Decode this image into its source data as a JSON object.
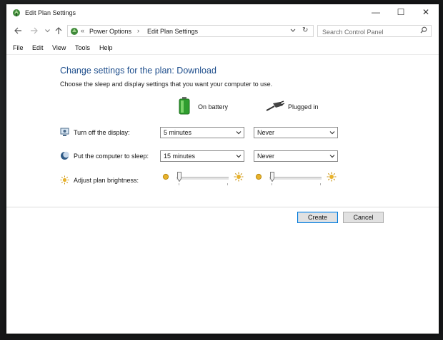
{
  "window": {
    "title": "Edit Plan Settings",
    "controls": {
      "minimize": "—",
      "maximize": "☐",
      "close": "✕"
    }
  },
  "navigation": {
    "back_icon": "arrow-left-icon",
    "forward_icon": "arrow-right-icon",
    "recent_icon": "chevron-down-icon",
    "up_icon": "arrow-up-icon",
    "breadcrumb_overflow": "«",
    "breadcrumbs": [
      "Power Options",
      "Edit Plan Settings"
    ],
    "breadcrumb_separator": "›",
    "search": {
      "placeholder": "Search Control Panel"
    }
  },
  "menu": [
    "File",
    "Edit",
    "View",
    "Tools",
    "Help"
  ],
  "content": {
    "heading": "Change settings for the plan: Download",
    "description": "Choose the sleep and display settings that you want your computer to use.",
    "columns": {
      "battery": "On battery",
      "plugged": "Plugged in"
    },
    "rows": [
      {
        "label": "Turn off the display:",
        "battery_value": "5 minutes",
        "plugged_value": "Never"
      },
      {
        "label": "Put the computer to sleep:",
        "battery_value": "15 minutes",
        "plugged_value": "Never"
      },
      {
        "label": "Adjust plan brightness:",
        "battery_brightness": 0.0,
        "plugged_brightness": 0.0
      }
    ]
  },
  "buttons": {
    "create": "Create",
    "cancel": "Cancel"
  },
  "colors": {
    "heading": "#1e4e8c",
    "accent": "#0078d7"
  }
}
